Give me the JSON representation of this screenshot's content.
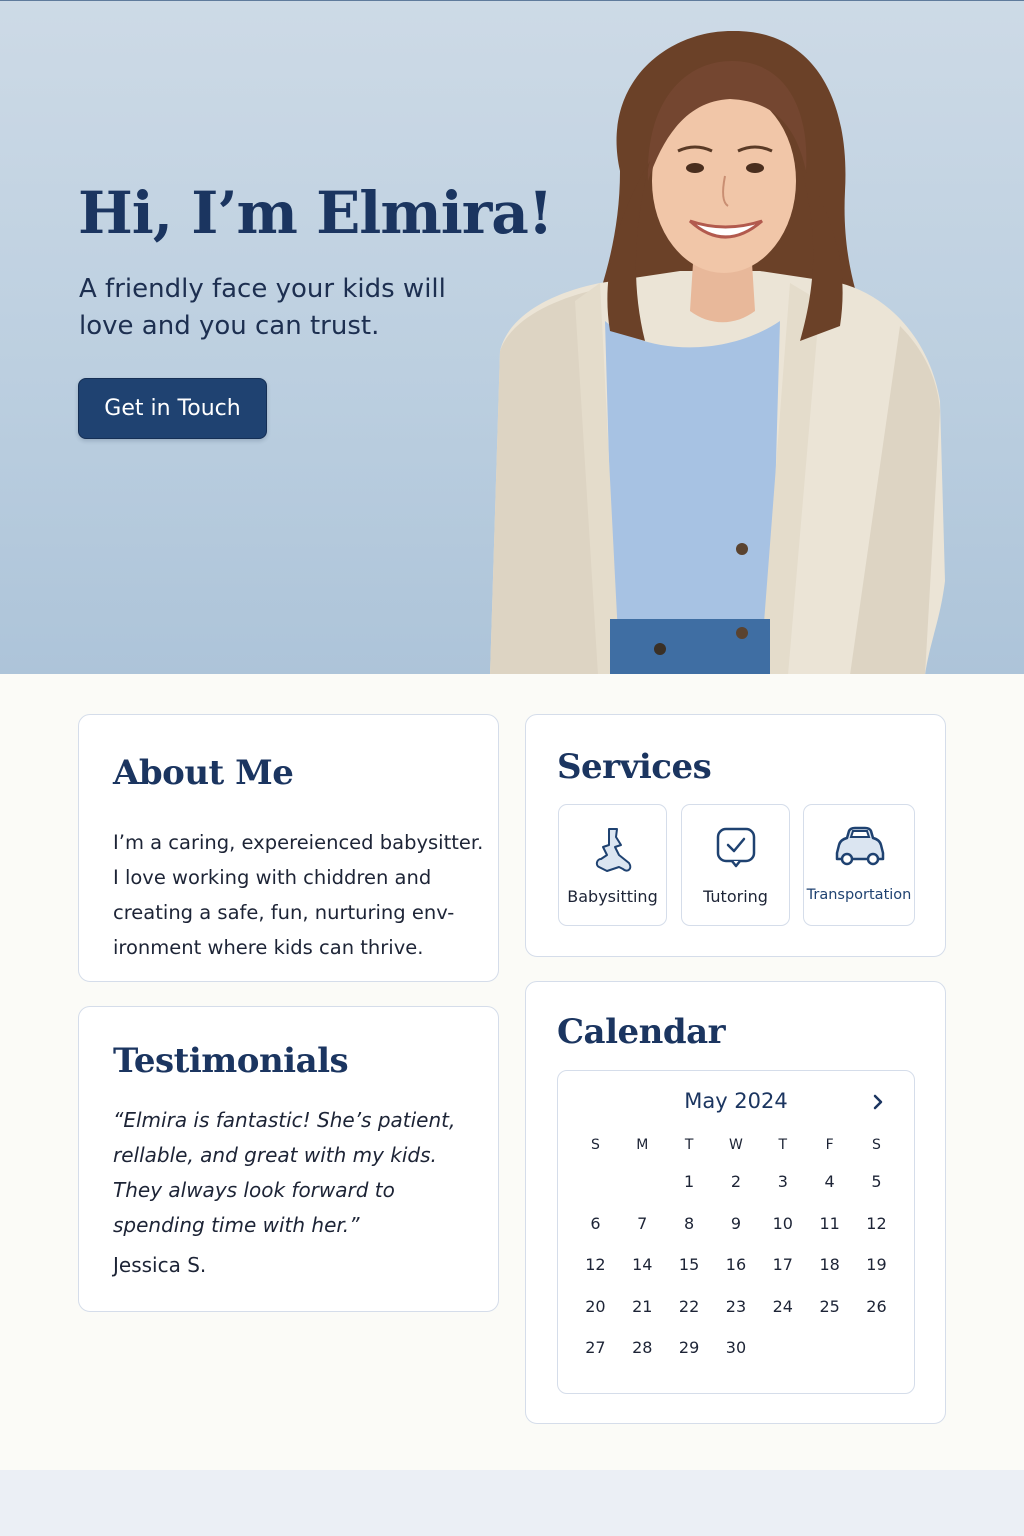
{
  "hero": {
    "title": "Hi, I’m Elmira!",
    "subtitle_lines": [
      "A friendly face your kids will",
      "love and you can trust."
    ],
    "cta_label": "Get in Touch"
  },
  "about": {
    "title": "About Me",
    "lines": [
      "I’m a caring, expereienced babysitter.",
      "I love working with chiddren and",
      "creating a safe, fun, nurturing env-",
      "ironment where kids can thrive."
    ]
  },
  "testimonials": {
    "title": "Testimonials",
    "quote_lines": [
      "“Elmira is fantastic! She’s patient,",
      "rellable, and great with my kids.",
      "They always look forward to",
      "spending time with her.”"
    ],
    "author": "Jessica S."
  },
  "services": {
    "title": "Services",
    "items": [
      {
        "label": "Babysitting",
        "icon": "babysitting-icon"
      },
      {
        "label": "Tutoring",
        "icon": "tutoring-check-icon"
      },
      {
        "label": "Transportation",
        "icon": "car-icon"
      }
    ]
  },
  "calendar": {
    "title": "Calendar",
    "month": "May 2024",
    "weekdays": [
      "S",
      "M",
      "T",
      "W",
      "T",
      "F",
      "S"
    ],
    "weeks": [
      [
        "",
        "",
        "1",
        "2",
        "3",
        "4",
        "5"
      ],
      [
        "6",
        "7",
        "8",
        "9",
        "10",
        "11",
        "12"
      ],
      [
        "12",
        "14",
        "15",
        "16",
        "17",
        "18",
        "19"
      ],
      [
        "20",
        "21",
        "22",
        "23",
        "24",
        "25",
        "26"
      ],
      [
        "27",
        "28",
        "29",
        "30",
        "",
        "",
        ""
      ]
    ]
  },
  "colors": {
    "primary": "#1f4271",
    "heading": "#1b3560",
    "hero_bg": "#c3d4e3",
    "card_border": "#d5ddea"
  }
}
